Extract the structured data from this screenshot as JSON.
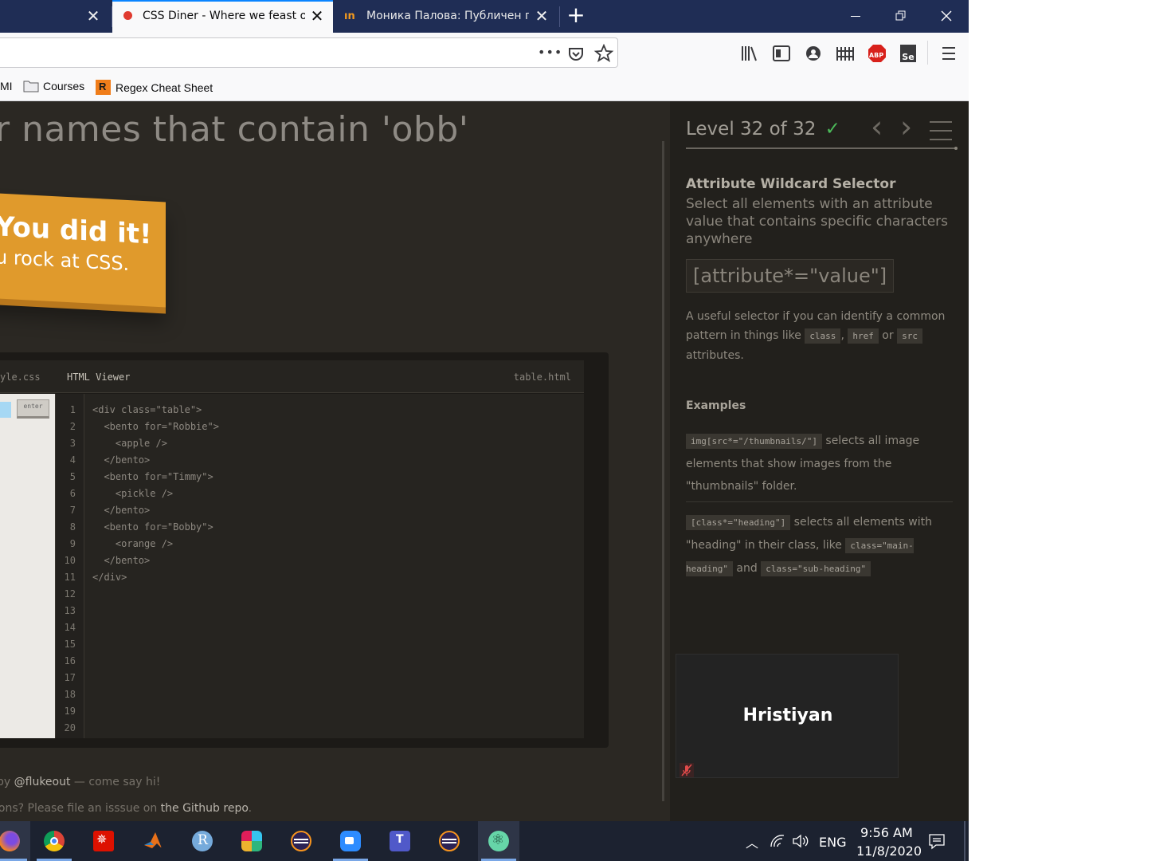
{
  "browser": {
    "tabs": [
      {
        "title": "",
        "active": false
      },
      {
        "title": "CSS Diner - Where we feast on",
        "active": true
      },
      {
        "title": "Моника Палова: Публичен пр",
        "active": false
      }
    ],
    "new_tab": "+",
    "window_controls": {
      "minimize": "—",
      "restore": "❐",
      "close": "✕"
    },
    "bookmarks": [
      {
        "label": "MI",
        "icon": "none"
      },
      {
        "label": "Courses",
        "icon": "folder-icon"
      },
      {
        "label": "Regex Cheat Sheet",
        "icon": "regex-favicon"
      }
    ],
    "toolbar_icons": [
      "page-actions-icon",
      "pocket-icon",
      "bookmark-star-icon",
      "library-icon",
      "sidebar-icon",
      "account-icon",
      "extension-icon",
      "adblock-icon",
      "selenium-icon",
      "menu-icon"
    ],
    "abp_label": "ABP",
    "se_label": "Se"
  },
  "page": {
    "level_title": "r names that contain 'obb'",
    "winner_line1": "You did it!",
    "winner_line2": "u rock at CSS.",
    "editor": {
      "css_tab": "yle.css",
      "html_title": "HTML Viewer",
      "html_file": "table.html",
      "enter_button": "enter",
      "line_numbers": [
        "1",
        "2",
        "3",
        "4",
        "5",
        "6",
        "7",
        "8",
        "9",
        "10",
        "11",
        "12",
        "13",
        "14",
        "15",
        "16",
        "17",
        "18",
        "19",
        "20"
      ],
      "code_lines": [
        "<div class=\"table\">",
        "  <bento for=\"Robbie\">",
        "    <apple />",
        "  </bento>",
        "  <bento for=\"Timmy\">",
        "    <pickle />",
        "  </bento>",
        "  <bento for=\"Bobby\">",
        "    <orange />",
        "  </bento>",
        "</div>"
      ]
    },
    "footer": {
      "line1_prefix": "by ",
      "line1_link": "@flukeout",
      "line1_suffix": " — come say hi!",
      "line2_prefix": "ions? Please file an isssue on ",
      "line2_link": "the Github repo",
      "line2_suffix": "."
    }
  },
  "sidebar": {
    "level": "Level 32 of 32",
    "check": "✓",
    "prev": "‹",
    "next": "›",
    "selector_name": "Attribute Wildcard Selector",
    "description": "Select all elements with an attribute value that contains specific characters anywhere",
    "syntax": "[attribute*=\"value\"]",
    "hint_part1": "A useful selector if you can identify a common pattern in things like ",
    "hint_code1": "class",
    "hint_sep1": ", ",
    "hint_code2": "href",
    "hint_sep2": " or ",
    "hint_code3": "src",
    "hint_part2": " attributes.",
    "examples_title": "Examples",
    "ex1_code": "img[src*=\"/thumbnails/\"]",
    "ex1_text": " selects all image elements that show images from the \"thumbnails\" folder.",
    "ex2_code": "[class*=\"heading\"]",
    "ex2_text1": " selects all elements with \"heading\" in their class, like ",
    "ex2_code2": "class=\"main-heading\"",
    "ex2_text2": " and ",
    "ex2_code3": "class=\"sub-heading\""
  },
  "video": {
    "participant": "Hristiyan",
    "muted_icon": "muted-mic-icon"
  },
  "taskbar": {
    "apps": [
      "firefox",
      "chrome",
      "wolfram",
      "matlab",
      "r",
      "slack",
      "eclipse",
      "zoom",
      "teams",
      "eclipse-2",
      "atom"
    ],
    "language": "ENG",
    "time": "9:56 AM",
    "date": "11/8/2020"
  }
}
